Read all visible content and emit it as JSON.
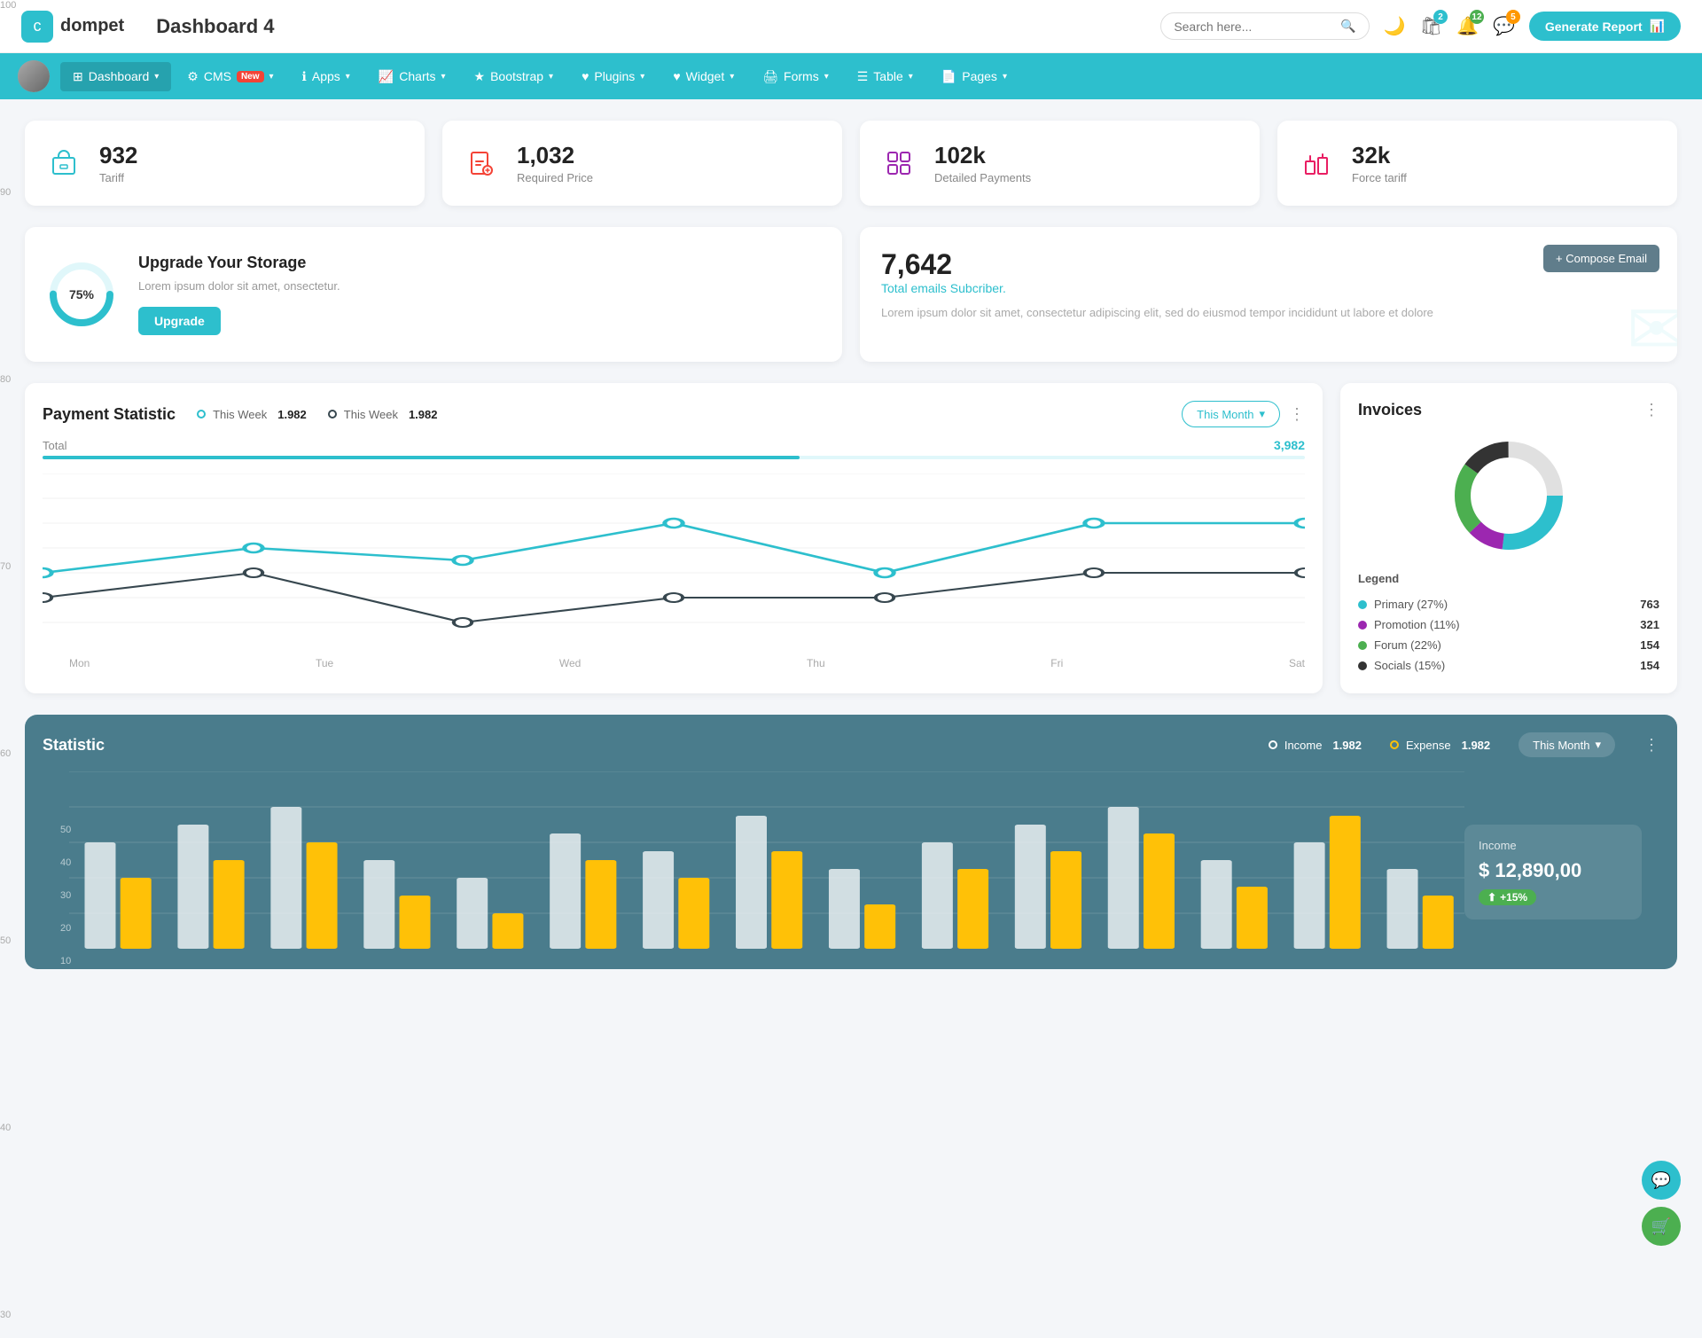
{
  "header": {
    "logo_icon": "💼",
    "logo_name": "dompet",
    "page_title": "Dashboard 4",
    "search_placeholder": "Search here...",
    "generate_btn": "Generate Report",
    "icons": {
      "moon": "🌙",
      "shop": "🛍",
      "notif1_count": "2",
      "notif2_count": "12",
      "notif3_count": "5"
    }
  },
  "nav": {
    "items": [
      {
        "id": "dashboard",
        "label": "Dashboard",
        "active": true,
        "arrow": true
      },
      {
        "id": "cms",
        "label": "CMS",
        "badge": "New",
        "arrow": true
      },
      {
        "id": "apps",
        "label": "Apps",
        "arrow": true
      },
      {
        "id": "charts",
        "label": "Charts",
        "arrow": true
      },
      {
        "id": "bootstrap",
        "label": "Bootstrap",
        "arrow": true
      },
      {
        "id": "plugins",
        "label": "Plugins",
        "arrow": true
      },
      {
        "id": "widget",
        "label": "Widget",
        "arrow": true
      },
      {
        "id": "forms",
        "label": "Forms",
        "arrow": true
      },
      {
        "id": "table",
        "label": "Table",
        "arrow": true
      },
      {
        "id": "pages",
        "label": "Pages",
        "arrow": true
      }
    ]
  },
  "stat_cards": [
    {
      "id": "tariff",
      "value": "932",
      "label": "Tariff",
      "icon": "briefcase",
      "color": "teal"
    },
    {
      "id": "required-price",
      "value": "1,032",
      "label": "Required Price",
      "icon": "file-plus",
      "color": "red"
    },
    {
      "id": "detailed-payments",
      "value": "102k",
      "label": "Detailed Payments",
      "icon": "grid",
      "color": "purple"
    },
    {
      "id": "force-tariff",
      "value": "32k",
      "label": "Force tariff",
      "icon": "building",
      "color": "pink"
    }
  ],
  "storage": {
    "percent": "75%",
    "title": "Upgrade Your Storage",
    "desc": "Lorem ipsum dolor sit amet, onsectetur.",
    "btn_label": "Upgrade"
  },
  "email": {
    "count": "7,642",
    "subtitle": "Total emails Subcriber.",
    "desc": "Lorem ipsum dolor sit amet, consectetur adipiscing elit, sed do eiusmod tempor incididunt ut labore et dolore",
    "compose_btn": "+ Compose Email"
  },
  "payment": {
    "title": "Payment Statistic",
    "this_month_label": "This Month",
    "legend": [
      {
        "label": "This Week",
        "value": "1.982",
        "type": "teal"
      },
      {
        "label": "This Week",
        "value": "1.982",
        "type": "dark"
      }
    ],
    "total_label": "Total",
    "total_value": "3,982",
    "x_labels": [
      "Mon",
      "Tue",
      "Wed",
      "Thu",
      "Fri",
      "Sat"
    ],
    "y_labels": [
      "100",
      "90",
      "80",
      "70",
      "60",
      "50",
      "40",
      "30"
    ]
  },
  "invoices": {
    "title": "Invoices",
    "legend": [
      {
        "label": "Primary (27%)",
        "value": "763",
        "color": "#2dbfcd"
      },
      {
        "label": "Promotion (11%)",
        "value": "321",
        "color": "#9c27b0"
      },
      {
        "label": "Forum (22%)",
        "value": "154",
        "color": "#4caf50"
      },
      {
        "label": "Socials (15%)",
        "value": "154",
        "color": "#333"
      }
    ]
  },
  "statistic": {
    "title": "Statistic",
    "this_month_label": "This Month",
    "income_label": "Income",
    "expense_label": "Expense",
    "income_value": "1.982",
    "expense_value": "1.982",
    "y_labels": [
      "50",
      "40",
      "30",
      "20",
      "10"
    ],
    "income_panel": {
      "title": "Income",
      "amount": "$ 12,890,00",
      "badge": "+15%"
    }
  },
  "float_btns": {
    "support": "💬",
    "cart": "🛒"
  }
}
